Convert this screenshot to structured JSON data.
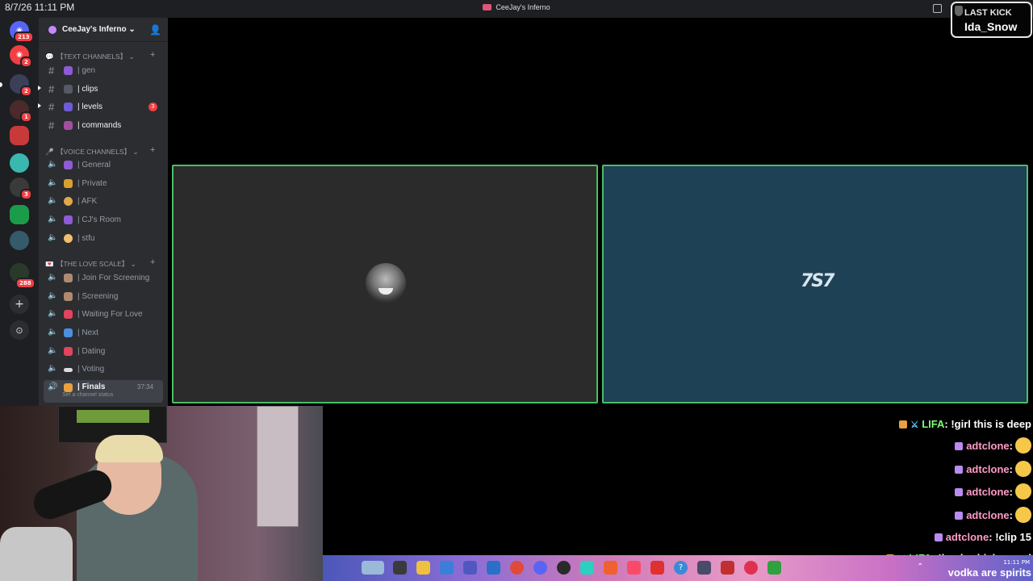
{
  "topbar": {
    "datetime": "8/7/26 11:11 PM",
    "window_title": "CeeJay's Inferno"
  },
  "last_kick": {
    "label": "LAST KICK",
    "name": "Ida_Snow"
  },
  "server_rail": {
    "badges": [
      "213",
      "2",
      "2",
      "1",
      "3",
      "288"
    ]
  },
  "server": {
    "name": "CeeJay's Inferno"
  },
  "categories": {
    "text": "【TEXT CHANNELS】",
    "voice": "【VOICE CHANNELS】",
    "love": "【THE LOVE SCALE】"
  },
  "text_channels": [
    {
      "label": "| gen"
    },
    {
      "label": "| clips"
    },
    {
      "label": "| levels",
      "badge": "3"
    },
    {
      "label": "| commands"
    }
  ],
  "voice_channels": [
    {
      "label": "| General"
    },
    {
      "label": "| Private"
    },
    {
      "label": "| AFK"
    },
    {
      "label": "| CJ's Room"
    },
    {
      "label": "| stfu"
    }
  ],
  "love_channels": [
    {
      "label": "| Join For Screening"
    },
    {
      "label": "| Screening"
    },
    {
      "label": "| Waiting For Love"
    },
    {
      "label": "| Next"
    },
    {
      "label": "| Dating"
    },
    {
      "label": "| Voting"
    },
    {
      "label": "| Finals",
      "time": "37:34",
      "status": "Set a channel status"
    }
  ],
  "call": {
    "tile2_logo": "7S7"
  },
  "chat": [
    {
      "user": "LIFA",
      "text": " !girl this is deep"
    },
    {
      "user": "adtclone",
      "text": ""
    },
    {
      "user": "adtclone",
      "text": ""
    },
    {
      "user": "adtclone",
      "text": ""
    },
    {
      "user": "adtclone",
      "text": ""
    },
    {
      "user": "adtclone",
      "text": " !clip 15"
    },
    {
      "user": "LIFA",
      "text": " !hank whiskey and"
    },
    {
      "user": "",
      "text": "vodka are spirits"
    }
  ],
  "taskbar": {
    "clock": "11:11 PM"
  },
  "colors": {
    "speaking_border": "#4bbd67",
    "mention_badge": "#f23f43",
    "sidebar_bg": "#2b2d31"
  }
}
